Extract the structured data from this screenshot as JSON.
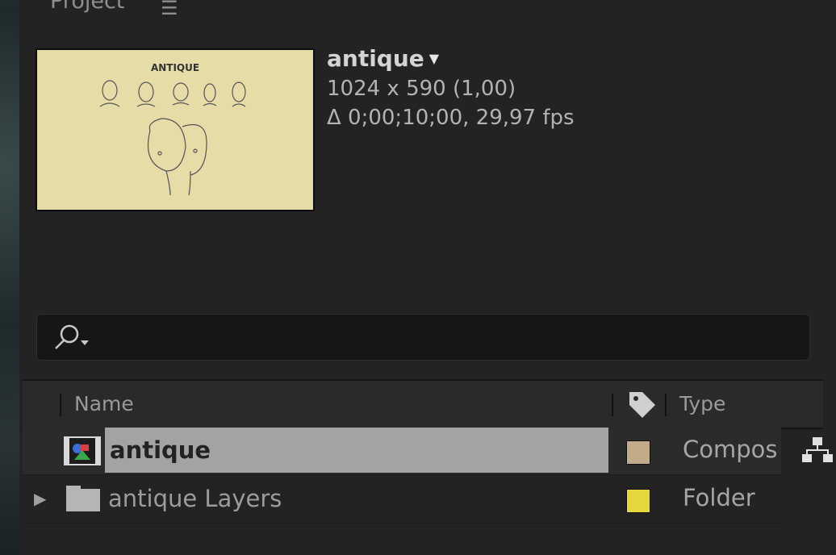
{
  "panel": {
    "tab_label": "Project",
    "menu_icon": "hamburger-menu-icon"
  },
  "composition": {
    "name": "antique",
    "dimensions": "1024 x 590 (1,00)",
    "duration": "Δ 0;00;10;00, 29,97 fps",
    "thumbnail_title": "ANTIQUE"
  },
  "search": {
    "value": "",
    "icon": "search-icon"
  },
  "columns": {
    "name": "Name",
    "label_icon": "tag-icon",
    "type": "Type"
  },
  "items": [
    {
      "name": "antique",
      "type": "Compos",
      "label_color": "#c1ab88",
      "icon": "composition-icon",
      "selected": true
    },
    {
      "name": "antique Layers",
      "type": "Folder",
      "label_color": "#e6d63f",
      "icon": "folder-icon",
      "selected": false
    }
  ],
  "colors": {
    "panel_bg": "#232323",
    "selection": "#a3a3a3"
  }
}
